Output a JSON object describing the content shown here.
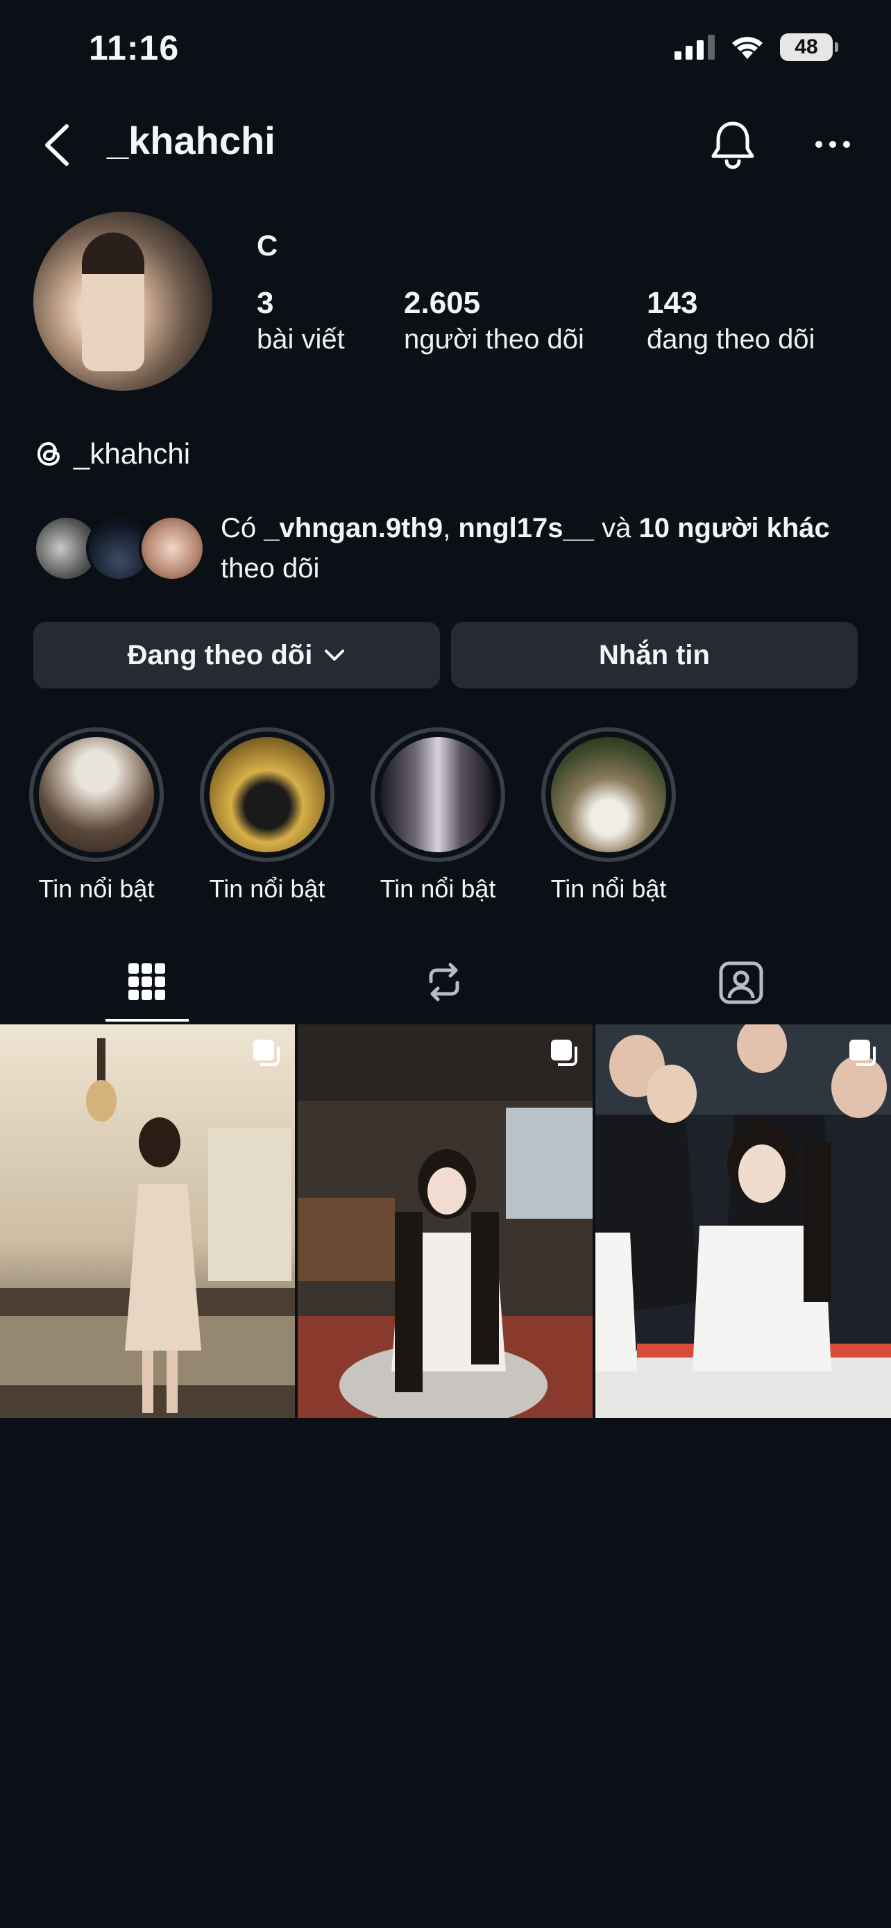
{
  "status_bar": {
    "time": "11:16",
    "battery": "48"
  },
  "header": {
    "username": "_khahchi"
  },
  "profile": {
    "display_name": "C",
    "stats": [
      {
        "value": "3",
        "label": "bài viết"
      },
      {
        "value": "2.605",
        "label": "người theo dõi"
      },
      {
        "value": "143",
        "label": "đang theo dõi"
      }
    ],
    "threads_handle": "_khahchi"
  },
  "followed_by": {
    "prefix": "Có ",
    "user1": "_vhngan.9th9",
    "sep": ", ",
    "user2": "nngl17s__",
    "and": " và ",
    "others": "10 người khác",
    "suffix": " theo dõi"
  },
  "buttons": {
    "following": "Đang theo dõi",
    "message": "Nhắn tin"
  },
  "highlights": [
    {
      "label": "Tin nổi bật"
    },
    {
      "label": "Tin nổi bật"
    },
    {
      "label": "Tin nổi bật"
    },
    {
      "label": "Tin nổi bật"
    }
  ],
  "tabs": [
    "grid-icon",
    "reposts-icon",
    "tagged-icon"
  ],
  "colors": {
    "background": "#0b1016",
    "button": "#262b33",
    "text": "#f5f5f5"
  }
}
